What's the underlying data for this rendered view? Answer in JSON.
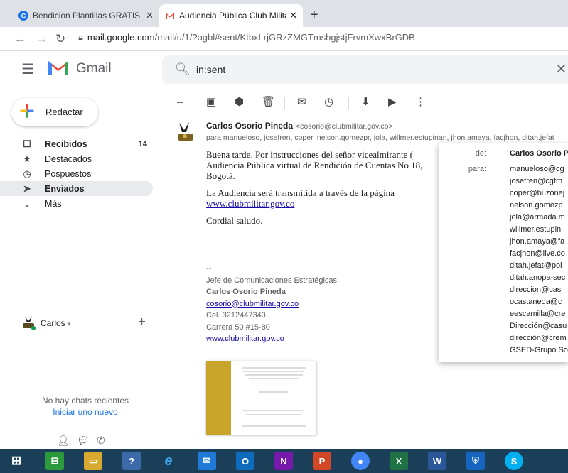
{
  "browser": {
    "tabs": [
      {
        "title": "Bendicion Plantillas GRATIS - Pla",
        "close": "✕"
      },
      {
        "title": "Audiencia Pública Club Militar - c",
        "close": "✕"
      }
    ],
    "new_tab": "+",
    "url_host": "mail.google.com",
    "url_path": "/mail/u/1/?ogbl#sent/KtbxLrjGRzZMGTmshgjstjFrvmXwxBrGDB"
  },
  "gmail": {
    "product_name": "Gmail",
    "search_value": "in:sent",
    "compose_label": "Redactar",
    "nav": [
      {
        "label": "Recibidos",
        "count": "14",
        "icon": "inbox-icon"
      },
      {
        "label": "Destacados",
        "count": "",
        "icon": "star-icon"
      },
      {
        "label": "Pospuestos",
        "count": "",
        "icon": "clock-icon"
      },
      {
        "label": "Enviados",
        "count": "",
        "icon": "send-icon"
      },
      {
        "label": "Más",
        "count": "",
        "icon": "chevron-down-icon"
      }
    ],
    "hangouts": {
      "user": "Carlos",
      "no_chats": "No hay chats recientes",
      "start_new": "Iniciar uno nuevo"
    }
  },
  "message": {
    "sender_name": "Carlos Osorio Pineda",
    "sender_email": "<cosorio@clubmilitar.gov.co>",
    "recipients_line": "para manueloso, josefren, coper, nelson.gomezpr, jola, willmer.estupinan, jhon.amaya, facjhon, ditah.jefat",
    "body_p1": "Buena tarde. Por instrucciones del señor vicealmirante (",
    "body_p1b": "Audiencia Pública virtual de Rendición de Cuentas No 18,",
    "body_p1c": "Bogotá.",
    "body_p2": "La Audiencia será transmitida a través de la página",
    "body_link": "www.clubmilitar.gov.co",
    "body_p3": "Cordial saludo.",
    "sig_dash": "--",
    "sig_role": "Jefe de Comunicaciones Estratégicas",
    "sig_name": "Carlos Osorio Pineda",
    "sig_email": "cosorio@clubmilitar.gov.co",
    "sig_phone": "Cel. 3212447340",
    "sig_address": "Carrera 50 #15-80",
    "sig_web": "www.clubmilitar.gov.co"
  },
  "popup": {
    "from_label": "de:",
    "from_value": "Carlos Osorio P",
    "to_label": "para:",
    "to_list": [
      "manueloso@cg",
      "josefren@cgfm",
      "coper@buzonej",
      "nelson.gomezp",
      "jola@armada.m",
      "willmer.estupin",
      "jhon.amaya@fa",
      "facjhon@live.co",
      "ditah.jefat@pol",
      "ditah.anopa-sec",
      "direccion@cas",
      "ocastaneda@c",
      "eescamilla@cre",
      "Dirección@casu",
      "dirección@crem",
      "GSED-Grupo So"
    ]
  },
  "colors": {
    "gmail_red": "#ea4335",
    "active_nav": "#e8eaed",
    "link": "#1a0dab",
    "taskbar": "#1b3f58"
  }
}
